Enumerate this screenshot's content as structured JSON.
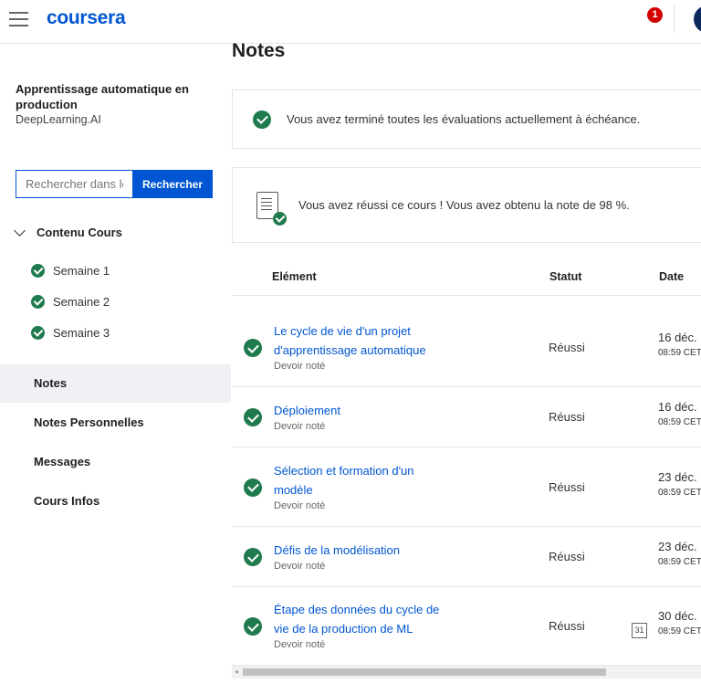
{
  "header": {
    "logo": "coursera",
    "notification_count": "1"
  },
  "sidebar": {
    "course_title": "Apprentissage automatique en production",
    "partner": "DeepLearning.AI",
    "search_placeholder": "Rechercher dans le cours",
    "search_button": "Rechercher",
    "content_label": "Contenu Cours",
    "weeks": [
      "Semaine 1",
      "Semaine 2",
      "Semaine 3"
    ],
    "nav": [
      "Notes",
      "Notes Personnelles",
      "Messages",
      "Cours Infos"
    ]
  },
  "main": {
    "title": "Notes",
    "banner1": "Vous avez terminé toutes les évaluations actuellement à échéance.",
    "banner2": "Vous avez réussi ce cours ! Vous avez obtenu la note de 98 %.",
    "columns": [
      "Elément",
      "Statut",
      "Date"
    ],
    "rows": [
      {
        "title_lines": [
          "Le cycle de vie d'un projet",
          "d'apprentissage automatique"
        ],
        "type": "Devoir noté",
        "status": "Réussi",
        "date": "16 déc.",
        "time": "08:59 CET"
      },
      {
        "title_lines": [
          "Déploiement"
        ],
        "type": "Devoir noté",
        "status": "Réussi",
        "date": "16 déc.",
        "time": "08:59 CET"
      },
      {
        "title_lines": [
          "Sélection et formation d'un",
          "modèle"
        ],
        "type": "Devoir noté",
        "status": "Réussi",
        "date": "23 déc.",
        "time": "08:59 CET"
      },
      {
        "title_lines": [
          "Défis de la modélisation"
        ],
        "type": "Devoir noté",
        "status": "Réussi",
        "date": "23 déc.",
        "time": "08:59 CET"
      },
      {
        "title_lines": [
          "Étape des données du cycle de",
          "vie de la production de ML"
        ],
        "type": "Devoir noté",
        "status": "Réussi",
        "date": "30 déc.",
        "time": "08:59 CET",
        "calendar": "31"
      }
    ]
  },
  "colors": {
    "brand": "#0056d2",
    "success": "#1f7a4d",
    "badge": "#d30001"
  }
}
